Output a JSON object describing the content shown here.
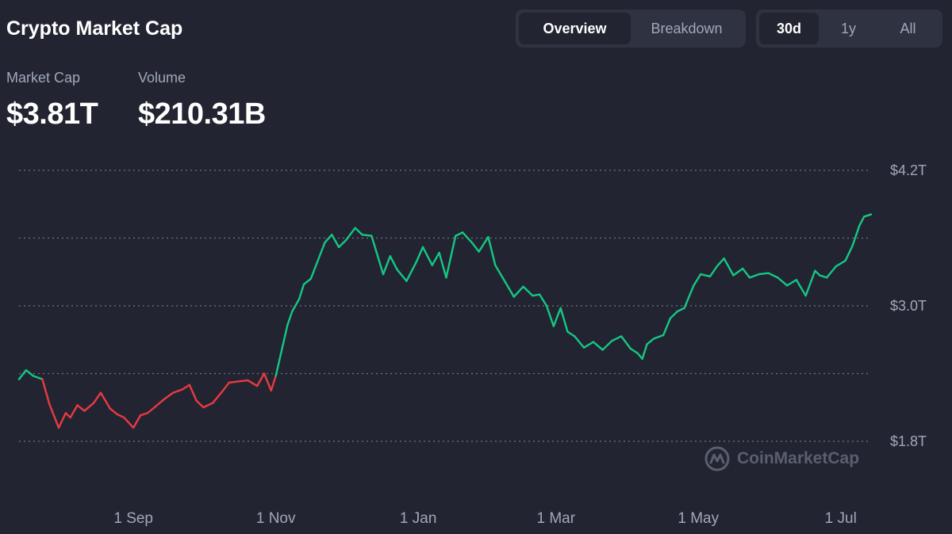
{
  "header": {
    "title": "Crypto Market Cap",
    "view_tabs": [
      {
        "label": "Overview",
        "active": true
      },
      {
        "label": "Breakdown",
        "active": false
      }
    ],
    "range_tabs": [
      {
        "label": "30d",
        "active": true
      },
      {
        "label": "1y",
        "active": false
      },
      {
        "label": "All",
        "active": false
      }
    ]
  },
  "stats": {
    "market_cap_label": "Market Cap",
    "market_cap_value": "$3.81T",
    "volume_label": "Volume",
    "volume_value": "$210.31B"
  },
  "watermark": {
    "text": "CoinMarketCap",
    "icon": "coinmarketcap-logo-icon"
  },
  "colors": {
    "background": "#222531",
    "up": "#16c784",
    "down": "#ea3943",
    "grid": "#6b7082",
    "muted": "#a1a7bb"
  },
  "chart_data": {
    "type": "line",
    "title": "",
    "xlabel": "",
    "ylabel": "",
    "ylim": [
      1.8,
      4.2
    ],
    "y_ticks": [
      {
        "value": 4.2,
        "label": "$4.2T"
      },
      {
        "value": 3.6,
        "label": ""
      },
      {
        "value": 3.0,
        "label": "$3.0T"
      },
      {
        "value": 2.4,
        "label": ""
      },
      {
        "value": 1.8,
        "label": "$1.8T"
      }
    ],
    "x_ticks": [
      {
        "value": "2024-09-01",
        "label": "1 Sep"
      },
      {
        "value": "2024-11-01",
        "label": "1 Nov"
      },
      {
        "value": "2025-01-01",
        "label": "1 Jan"
      },
      {
        "value": "2025-03-01",
        "label": "1 Mar"
      },
      {
        "value": "2025-05-01",
        "label": "1 May"
      },
      {
        "value": "2025-07-01",
        "label": "1 Jul"
      }
    ],
    "xlim": [
      "2024-07-14",
      "2025-07-14"
    ],
    "baseline": 2.35,
    "grid": true,
    "series": [
      {
        "x": [
          "2024-07-14",
          "2024-07-17",
          "2024-07-20",
          "2024-07-24",
          "2024-07-27",
          "2024-07-31",
          "2024-08-03",
          "2024-08-05",
          "2024-08-08",
          "2024-08-11",
          "2024-08-15",
          "2024-08-18",
          "2024-08-22",
          "2024-08-25",
          "2024-08-28",
          "2024-09-01",
          "2024-09-04",
          "2024-09-07",
          "2024-09-10",
          "2024-09-14",
          "2024-09-18",
          "2024-09-22",
          "2024-09-25",
          "2024-09-28",
          "2024-10-01",
          "2024-10-05",
          "2024-10-09",
          "2024-10-12",
          "2024-10-16",
          "2024-10-20",
          "2024-10-24",
          "2024-10-27",
          "2024-10-30",
          "2024-11-01",
          "2024-11-04",
          "2024-11-06",
          "2024-11-08",
          "2024-11-11",
          "2024-11-13",
          "2024-11-16",
          "2024-11-19",
          "2024-11-22",
          "2024-11-25",
          "2024-11-28",
          "2024-12-01",
          "2024-12-05",
          "2024-12-08",
          "2024-12-12",
          "2024-12-17",
          "2024-12-20",
          "2024-12-23",
          "2024-12-27",
          "2024-12-31",
          "2025-01-03",
          "2025-01-07",
          "2025-01-10",
          "2025-01-13",
          "2025-01-17",
          "2025-01-20",
          "2025-01-24",
          "2025-01-27",
          "2025-01-31",
          "2025-02-03",
          "2025-02-07",
          "2025-02-11",
          "2025-02-15",
          "2025-02-19",
          "2025-02-22",
          "2025-02-25",
          "2025-02-28",
          "2025-03-03",
          "2025-03-06",
          "2025-03-09",
          "2025-03-13",
          "2025-03-17",
          "2025-03-21",
          "2025-03-25",
          "2025-03-29",
          "2025-04-02",
          "2025-04-05",
          "2025-04-07",
          "2025-04-09",
          "2025-04-12",
          "2025-04-16",
          "2025-04-19",
          "2025-04-22",
          "2025-04-25",
          "2025-04-29",
          "2025-05-02",
          "2025-05-06",
          "2025-05-09",
          "2025-05-12",
          "2025-05-16",
          "2025-05-20",
          "2025-05-23",
          "2025-05-27",
          "2025-05-31",
          "2025-06-04",
          "2025-06-08",
          "2025-06-12",
          "2025-06-16",
          "2025-06-20",
          "2025-06-22",
          "2025-06-25",
          "2025-06-29",
          "2025-07-03",
          "2025-07-06",
          "2025-07-09",
          "2025-07-11",
          "2025-07-14"
        ],
        "values": [
          2.35,
          2.43,
          2.38,
          2.35,
          2.13,
          1.92,
          2.05,
          2.01,
          2.12,
          2.07,
          2.14,
          2.23,
          2.09,
          2.04,
          2.01,
          1.92,
          2.03,
          2.05,
          2.1,
          2.17,
          2.23,
          2.26,
          2.3,
          2.16,
          2.1,
          2.14,
          2.24,
          2.32,
          2.33,
          2.34,
          2.29,
          2.4,
          2.25,
          2.38,
          2.65,
          2.83,
          2.95,
          3.06,
          3.19,
          3.24,
          3.4,
          3.56,
          3.63,
          3.52,
          3.58,
          3.69,
          3.63,
          3.62,
          3.28,
          3.44,
          3.32,
          3.22,
          3.38,
          3.52,
          3.36,
          3.47,
          3.25,
          3.62,
          3.65,
          3.56,
          3.48,
          3.61,
          3.36,
          3.22,
          3.08,
          3.17,
          3.09,
          3.1,
          3.0,
          2.82,
          2.98,
          2.77,
          2.73,
          2.63,
          2.68,
          2.61,
          2.69,
          2.73,
          2.62,
          2.58,
          2.53,
          2.66,
          2.71,
          2.74,
          2.89,
          2.95,
          2.98,
          3.18,
          3.28,
          3.26,
          3.35,
          3.42,
          3.27,
          3.33,
          3.25,
          3.28,
          3.29,
          3.25,
          3.18,
          3.23,
          3.09,
          3.31,
          3.27,
          3.25,
          3.35,
          3.4,
          3.53,
          3.71,
          3.79,
          3.81
        ]
      }
    ]
  }
}
